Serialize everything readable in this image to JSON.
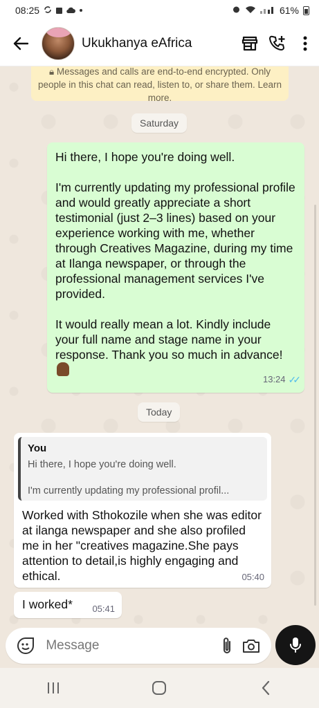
{
  "status_bar": {
    "time": "08:25",
    "battery": "61%"
  },
  "header": {
    "contact_name": "Ukukhanya eAfrica"
  },
  "chat": {
    "encryption_notice": "Messages and calls are end-to-end encrypted. Only people in this chat can read, listen to, or share them. Learn more.",
    "date_saturday": "Saturday",
    "date_today": "Today",
    "outgoing": {
      "p1": "Hi there, I hope you're doing well.",
      "p2": "I'm currently updating my professional profile and would greatly appreciate a short testimonial (just 2–3 lines) based on your experience working with me, whether through Creatives Magazine, during my time at Ilanga newspaper, or through the professional management services I've provided.",
      "p3": "It would really mean a lot. Kindly include your full name and stage name in your response. Thank you so much in advance!",
      "time": "13:24"
    },
    "reply": {
      "quote_author": "You",
      "quote_line1": "Hi there, I hope you're doing well.",
      "quote_line2": "I'm currently updating my professional profil...",
      "text": "Worked with Sthokozile when she was editor at ilanga newspaper and she also profiled me in her \"creatives magazine.She pays attention to detail,is highly engaging and ethical.",
      "time": "05:40"
    },
    "small": {
      "text": "I worked*",
      "time": "05:41"
    }
  },
  "input": {
    "placeholder": "Message"
  }
}
